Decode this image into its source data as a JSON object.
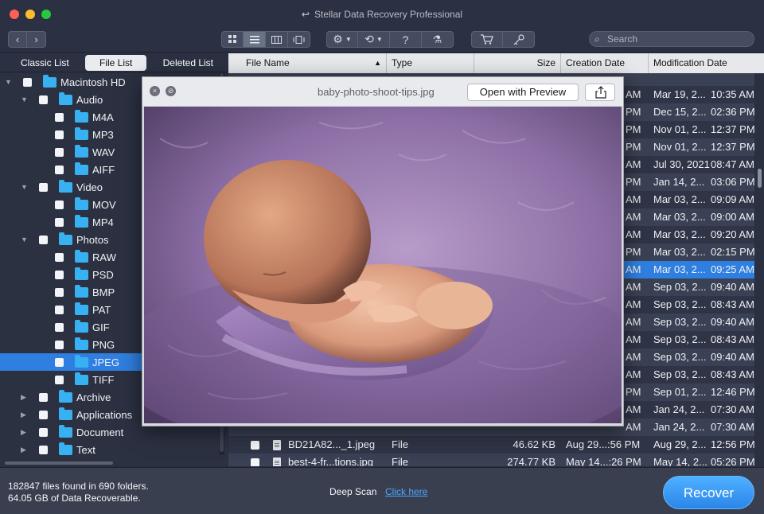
{
  "window": {
    "title": "Stellar Data Recovery Professional"
  },
  "toolbar": {
    "back_glyph": "‹",
    "forward_glyph": "›",
    "search_placeholder": "Search",
    "view_icons": [
      "grid-view-icon",
      "list-view-icon",
      "column-view-icon",
      "coverflow-view-icon"
    ],
    "tool_icons": [
      "gear-icon",
      "history-icon",
      "help-icon",
      "scan-icon",
      "cart-icon",
      "key-icon"
    ]
  },
  "left_tabs": [
    {
      "label": "Classic List",
      "active": false
    },
    {
      "label": "File List",
      "active": true
    },
    {
      "label": "Deleted List",
      "active": false
    }
  ],
  "tree": [
    {
      "label": "Macintosh HD",
      "level": 0,
      "expanded": true
    },
    {
      "label": "Audio",
      "level": 1,
      "expanded": true
    },
    {
      "label": "M4A",
      "level": 2
    },
    {
      "label": "MP3",
      "level": 2
    },
    {
      "label": "WAV",
      "level": 2
    },
    {
      "label": "AIFF",
      "level": 2
    },
    {
      "label": "Video",
      "level": 1,
      "expanded": true
    },
    {
      "label": "MOV",
      "level": 2
    },
    {
      "label": "MP4",
      "level": 2
    },
    {
      "label": "Photos",
      "level": 1,
      "expanded": true
    },
    {
      "label": "RAW",
      "level": 2
    },
    {
      "label": "PSD",
      "level": 2
    },
    {
      "label": "BMP",
      "level": 2
    },
    {
      "label": "PAT",
      "level": 2
    },
    {
      "label": "GIF",
      "level": 2
    },
    {
      "label": "PNG",
      "level": 2
    },
    {
      "label": "JPEG",
      "level": 2,
      "selected": true
    },
    {
      "label": "TIFF",
      "level": 2
    },
    {
      "label": "Archive",
      "level": 1,
      "expanded": false
    },
    {
      "label": "Applications",
      "level": 1,
      "expanded": false
    },
    {
      "label": "Document",
      "level": 1,
      "expanded": false
    },
    {
      "label": "Text",
      "level": 1,
      "expanded": false
    }
  ],
  "table": {
    "columns": [
      "File Name",
      "Type",
      "Size",
      "Creation Date",
      "Modification Date"
    ],
    "sort_glyph": "▲",
    "rows": [
      {
        "creation": "",
        "mod_date": "",
        "mod_time": ""
      },
      {
        "creation": "AM",
        "mod_date": "Mar 19, 2...",
        "mod_time": "10:35 AM"
      },
      {
        "creation": "PM",
        "mod_date": "Dec 15, 2...",
        "mod_time": "02:36 PM"
      },
      {
        "creation": "PM",
        "mod_date": "Nov 01, 2...",
        "mod_time": "12:37 PM"
      },
      {
        "creation": "PM",
        "mod_date": "Nov 01, 2...",
        "mod_time": "12:37 PM"
      },
      {
        "creation": "AM",
        "mod_date": "Jul 30, 2021",
        "mod_time": "08:47 AM"
      },
      {
        "creation": "PM",
        "mod_date": "Jan 14, 2...",
        "mod_time": "03:06 PM"
      },
      {
        "creation": "AM",
        "mod_date": "Mar 03, 2...",
        "mod_time": "09:09 AM"
      },
      {
        "creation": "AM",
        "mod_date": "Mar 03, 2...",
        "mod_time": "09:00 AM"
      },
      {
        "creation": "AM",
        "mod_date": "Mar 03, 2...",
        "mod_time": "09:20 AM"
      },
      {
        "creation": "PM",
        "mod_date": "Mar 03, 2...",
        "mod_time": "02:15 PM"
      },
      {
        "creation": "AM",
        "mod_date": "Mar 03, 2...",
        "mod_time": "09:25 AM",
        "highlight": true
      },
      {
        "creation": "AM",
        "mod_date": "Sep 03, 2...",
        "mod_time": "09:40 AM"
      },
      {
        "creation": "AM",
        "mod_date": "Sep 03, 2...",
        "mod_time": "08:43 AM"
      },
      {
        "creation": "AM",
        "mod_date": "Sep 03, 2...",
        "mod_time": "09:40 AM"
      },
      {
        "creation": "AM",
        "mod_date": "Sep 03, 2...",
        "mod_time": "08:43 AM"
      },
      {
        "creation": "AM",
        "mod_date": "Sep 03, 2...",
        "mod_time": "09:40 AM"
      },
      {
        "creation": "AM",
        "mod_date": "Sep 03, 2...",
        "mod_time": "08:43 AM"
      },
      {
        "creation": "PM",
        "mod_date": "Sep 01, 2...",
        "mod_time": "12:46 PM"
      },
      {
        "creation": "AM",
        "mod_date": "Jan 24, 2...",
        "mod_time": "07:30 AM"
      },
      {
        "creation": "AM",
        "mod_date": "Jan 24, 2...",
        "mod_time": "07:30 AM"
      },
      {
        "name": "BD21A82..._1.jpeg",
        "type": "File",
        "size": "46.62 KB",
        "creation": "Aug 29...:56 PM",
        "mod_date": "Aug 29, 2...",
        "mod_time": "12:56 PM",
        "full": true
      },
      {
        "name": "best-4-fr...tions.jpg",
        "type": "File",
        "size": "274.77 KB",
        "creation": "May 14...:26 PM",
        "mod_date": "May 14, 2...",
        "mod_time": "05:26 PM",
        "full": true
      }
    ]
  },
  "preview": {
    "filename": "baby-photo-shoot-tips.jpg",
    "open_label": "Open with Preview",
    "close_glyph": "×",
    "min_glyph": "⊘"
  },
  "footer": {
    "files_found": "182847 files found in 690 folders.",
    "data_recoverable": "64.05 GB of Data Recoverable.",
    "deep_scan_label": "Deep Scan",
    "deep_scan_link": "Click here",
    "recover_label": "Recover"
  },
  "colors": {
    "accent": "#2f7fe0",
    "folder": "#38b1f3",
    "panel": "#2c3142"
  }
}
